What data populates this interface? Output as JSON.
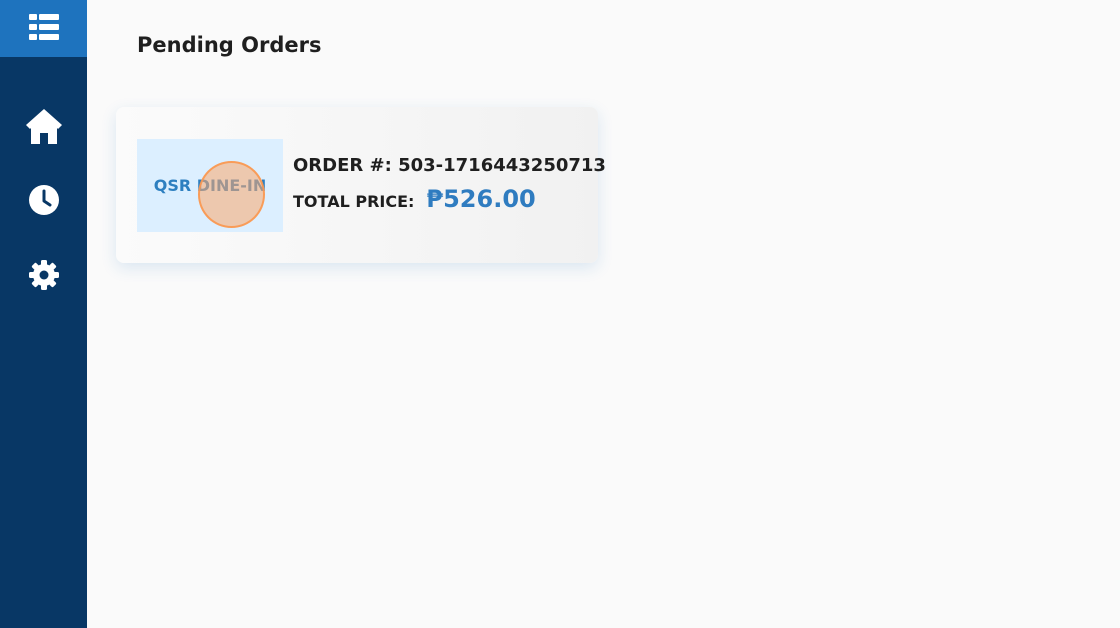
{
  "sidebar": {
    "top_icon": "list-grid-icon",
    "items": [
      {
        "name": "home",
        "icon": "home-icon"
      },
      {
        "name": "history",
        "icon": "clock-icon"
      },
      {
        "name": "settings",
        "icon": "gear-icon"
      }
    ]
  },
  "main": {
    "title": "Pending Orders",
    "orders": [
      {
        "type_label": "QSR DINE-IN",
        "order_number": "ORDER #: 503-1716443250713",
        "total_label": "TOTAL PRICE:",
        "total_value": "₱526.00"
      }
    ]
  },
  "colors": {
    "sidebar": "#083765",
    "sidebar_top": "#1e73be",
    "accent": "#2f7cc0",
    "badge_bg": "#dcefff"
  }
}
